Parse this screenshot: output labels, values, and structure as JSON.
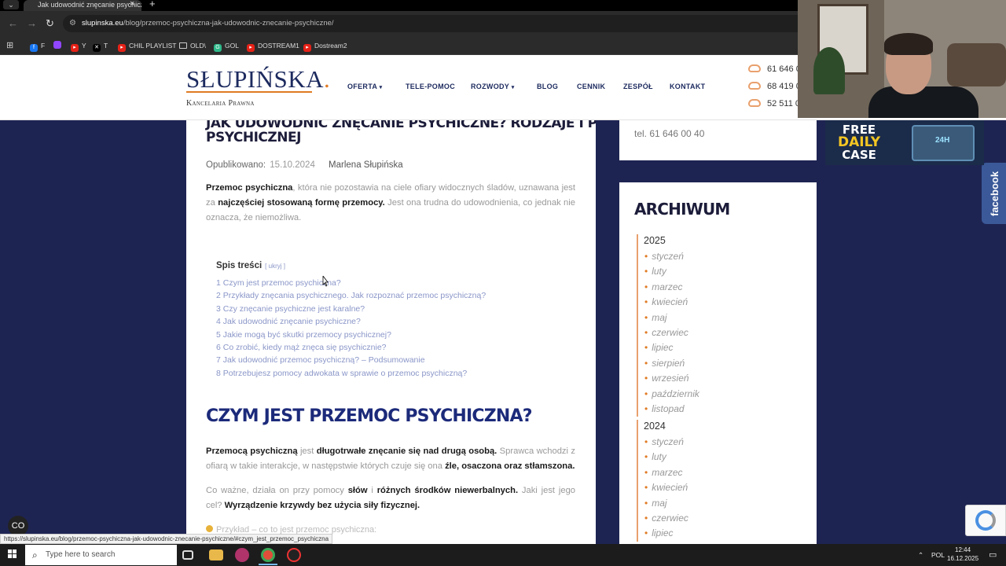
{
  "browser": {
    "tab_title": "Jak udowodnić znęcanie psychiczne",
    "url_host": "slupinska.eu",
    "url_path": "/blog/przemoc-psychiczna-jak-udowodnic-znecanie-psychiczne/",
    "bookmarks": [
      "F",
      "Y",
      "T",
      "CHIL PLAYLIST",
      "OLD\\",
      "GOL",
      "DOSTREAM1",
      "Dostream2"
    ]
  },
  "site": {
    "logo_main": "SŁUPIŃSKA",
    "logo_dot": ".",
    "logo_sub": "Kancelaria Prawna",
    "nav": [
      "OFERTA",
      "TELE-POMOC",
      "ROZWODY",
      "BLOG",
      "CENNIK",
      "ZESPÓŁ",
      "KONTAKT"
    ],
    "phones": [
      "61 646 0",
      "68 419 0",
      "52 511 0"
    ]
  },
  "article": {
    "title_cut": "JAK UDOWODNIĆ ZNĘCANIE PSYCHICZNE? RODZAJE I PRZYKŁADY PRZEMOCY",
    "title_line": "PSYCHICZNEJ",
    "published_label": "Opublikowano:",
    "published_date": "15.10.2024",
    "author": "Marlena Słupińska",
    "intro": {
      "b1": "Przemoc psychiczna",
      "t1": ", która nie pozostawia na ciele ofiary widocznych śladów, uznawana jest za ",
      "b2": "najczęściej stosowaną formę przemocy.",
      "t2": " Jest ona trudna do udowodnienia, co jednak nie oznacza, że niemożliwa."
    },
    "toc_title": "Spis treści",
    "toc_hide": "[ ukryj ]",
    "toc": [
      "1  Czym jest przemoc psychiczna?",
      "2  Przykłady znęcania psychicznego. Jak rozpoznać przemoc psychiczną?",
      "3  Czy znęcanie psychiczne jest karalne?",
      "4  Jak udowodnić znęcanie psychiczne?",
      "5  Jakie mogą być skutki przemocy psychicznej?",
      "6  Co zrobić, kiedy mąż znęca się psychicznie?",
      "7  Jak udowodnić przemoc psychiczną? – Podsumowanie",
      "8  Potrzebujesz pomocy adwokata w sprawie o przemoc psychiczną?"
    ],
    "h2": "CZYM JEST PRZEMOC PSYCHICZNA?",
    "p2": {
      "b1": "Przemocą psychiczną",
      "t1": " jest ",
      "b2": "długotrwałe znęcanie się nad drugą osobą.",
      "t2": " Sprawca wchodzi z ofiarą w takie interakcje, w następstwie których czuje się ona ",
      "b3": "źle, osaczona oraz stłamszona."
    },
    "p3": {
      "t1": "Co ważne, działa on przy pomocy ",
      "b1": "słów",
      "t2": " i ",
      "b2": "różnych środków niewerbalnych.",
      "t3": " Jaki jest jego cel? ",
      "b3": "Wyrządzenie krzywdy bez użycia siły fizycznej."
    },
    "example": "Przykład – co to jest przemoc psychiczna:"
  },
  "sidebar": {
    "phone": "tel. 61 646 00 40",
    "archive_title": "ARCHIWUM",
    "years": [
      {
        "year": "2025",
        "months": [
          "styczeń",
          "luty",
          "marzec",
          "kwiecień",
          "maj",
          "czerwiec",
          "lipiec",
          "sierpień",
          "wrzesień",
          "październik",
          "listopad"
        ]
      },
      {
        "year": "2024",
        "months": [
          "styczeń",
          "luty",
          "marzec",
          "kwiecień",
          "maj",
          "czerwiec",
          "lipiec"
        ]
      }
    ]
  },
  "overlays": {
    "facebook": "facebook",
    "ad_line1": "FREE",
    "ad_line2": "DAILY",
    "ad_line3": "CASE",
    "ad_badge": "24H",
    "status_url": "https://slupinska.eu/blog/przemoc-psychiczna-jak-udowodnic-znecanie-psychiczne/#czym_jest_przemoc_psychiczna"
  },
  "taskbar": {
    "search_placeholder": "Type here to search",
    "lang": "POL",
    "time": "12:44",
    "date": "16.12.2025"
  },
  "colors": {
    "navy": "#1c2a5e",
    "accent_orange": "#e07b24",
    "page_bg": "#1e2452",
    "toc_link": "#8a96c8"
  }
}
